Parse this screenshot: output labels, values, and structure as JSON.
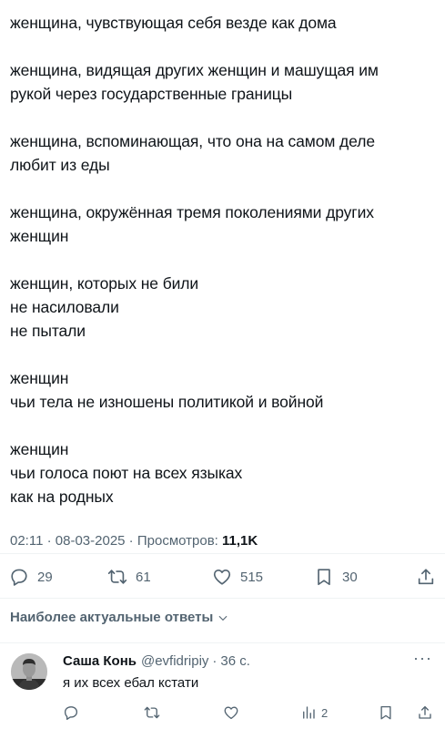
{
  "tweet": {
    "paragraphs": [
      {
        "lines": [
          "женщина, чувствующая себя везде как дома"
        ]
      },
      {
        "lines": [
          "женщина, видящая других женщин и машущая им",
          "рукой через государственные границы"
        ]
      },
      {
        "lines": [
          "женщина, вспоминающая, что она на самом деле",
          "любит из еды"
        ]
      },
      {
        "lines": [
          "женщина, окружённая тремя поколениями других",
          "женщин"
        ]
      },
      {
        "lines": [
          "женщин, которых не били",
          "не насиловали",
          "не пытали"
        ]
      },
      {
        "lines": [
          "женщин",
          "чьи тела не изношены политикой и войной"
        ]
      },
      {
        "lines": [
          "женщин",
          "чьи голоса поют на всех языках",
          "как на родных"
        ]
      }
    ],
    "meta": {
      "time": "02:11",
      "sep1": " · ",
      "date": "08-03-2025",
      "sep2": " · ",
      "views_label": "Просмотров: ",
      "views_count": "11,1K"
    },
    "actions": {
      "replies": "29",
      "retweets": "61",
      "likes": "515",
      "bookmarks": "30"
    }
  },
  "replies_header": {
    "label": "Наиболее актуальные ответы"
  },
  "reply": {
    "name": "Саша Конь",
    "handle": "@evfidripiy",
    "dot": "·",
    "time": "36 с.",
    "text": "я их всех ебал кстати",
    "more": "···",
    "views": "2"
  },
  "colors": {
    "text": "#0f1419",
    "secondary": "#536471",
    "divider": "#eff3f4"
  }
}
